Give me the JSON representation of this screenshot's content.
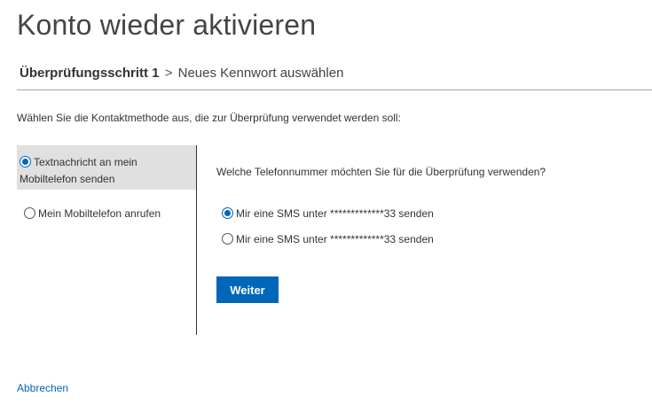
{
  "page": {
    "title": "Konto wieder aktivieren"
  },
  "breadcrumb": {
    "current_step": "Überprüfungsschritt 1",
    "separator": ">",
    "next_step": "Neues Kennwort auswählen"
  },
  "instruction": "Wählen Sie die Kontaktmethode aus, die zur Überprüfung verwendet werden soll:",
  "contact_methods": [
    {
      "label": "Textnachricht an mein Mobiltelefon senden",
      "selected": true
    },
    {
      "label": "Mein Mobiltelefon anrufen",
      "selected": false
    }
  ],
  "phone_selection": {
    "question": "Welche Telefonnummer möchten Sie für die Überprüfung verwenden?",
    "options": [
      {
        "label": "Mir eine SMS unter *************33 senden",
        "selected": true
      },
      {
        "label": "Mir eine SMS unter *************33 senden",
        "selected": false
      }
    ]
  },
  "actions": {
    "next_label": "Weiter",
    "cancel_label": "Abbrechen"
  },
  "colors": {
    "accent": "#0067b8",
    "selected_bg": "#e0e0e0",
    "divider": "#a6a6a6"
  }
}
